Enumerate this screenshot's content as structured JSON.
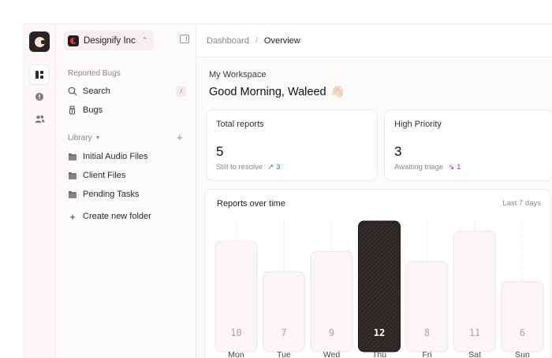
{
  "app": {
    "org_name": "Designify Inc",
    "rail": [
      {
        "icon": "dashboard-icon",
        "active": true
      },
      {
        "icon": "alert-circle-icon",
        "active": false
      },
      {
        "icon": "users-icon",
        "active": false
      }
    ]
  },
  "sidebar": {
    "section_title": "Reported Bugs",
    "search_label": "Search",
    "search_shortcut": "/",
    "bugs_label": "Bugs",
    "library_title": "Library",
    "folders": [
      {
        "label": "Initial Audio Files"
      },
      {
        "label": "Client Files"
      },
      {
        "label": "Pending Tasks"
      }
    ],
    "create_folder_label": "Create new folder"
  },
  "breadcrumb": {
    "parent": "Dashboard",
    "separator": "/",
    "current": "Overview"
  },
  "workspace": {
    "label": "My Workspace",
    "greeting": "Good Morning, Waleed",
    "greeting_emoji": "👋🏻"
  },
  "cards": {
    "total": {
      "title": "Total reports",
      "value": "5",
      "subtitle": "Still to resolve",
      "trend_icon": "↗",
      "trend_value": "3",
      "trend_color": "#2f9e44"
    },
    "priority": {
      "title": "High Priority",
      "value": "3",
      "subtitle": "Awaiting triage",
      "trend_icon": "↘",
      "trend_value": "1",
      "trend_color": "#d6342c"
    }
  },
  "chart_data": {
    "type": "bar",
    "title": "Reports over time",
    "range_label": "Last 7 days",
    "categories": [
      "Mon",
      "Tue",
      "Wed",
      "Thu",
      "Fri",
      "Sat",
      "Sun"
    ],
    "values": [
      10,
      7,
      9,
      12,
      8,
      11,
      6
    ],
    "highlight_index": 3,
    "ylim": [
      0,
      12
    ],
    "colors": {
      "bar": "#fbf6f6",
      "bar_border": "#efe6e6",
      "highlight": "#2b2624",
      "value_text": "#a8a2a2",
      "highlight_text": "#ffffff"
    }
  }
}
